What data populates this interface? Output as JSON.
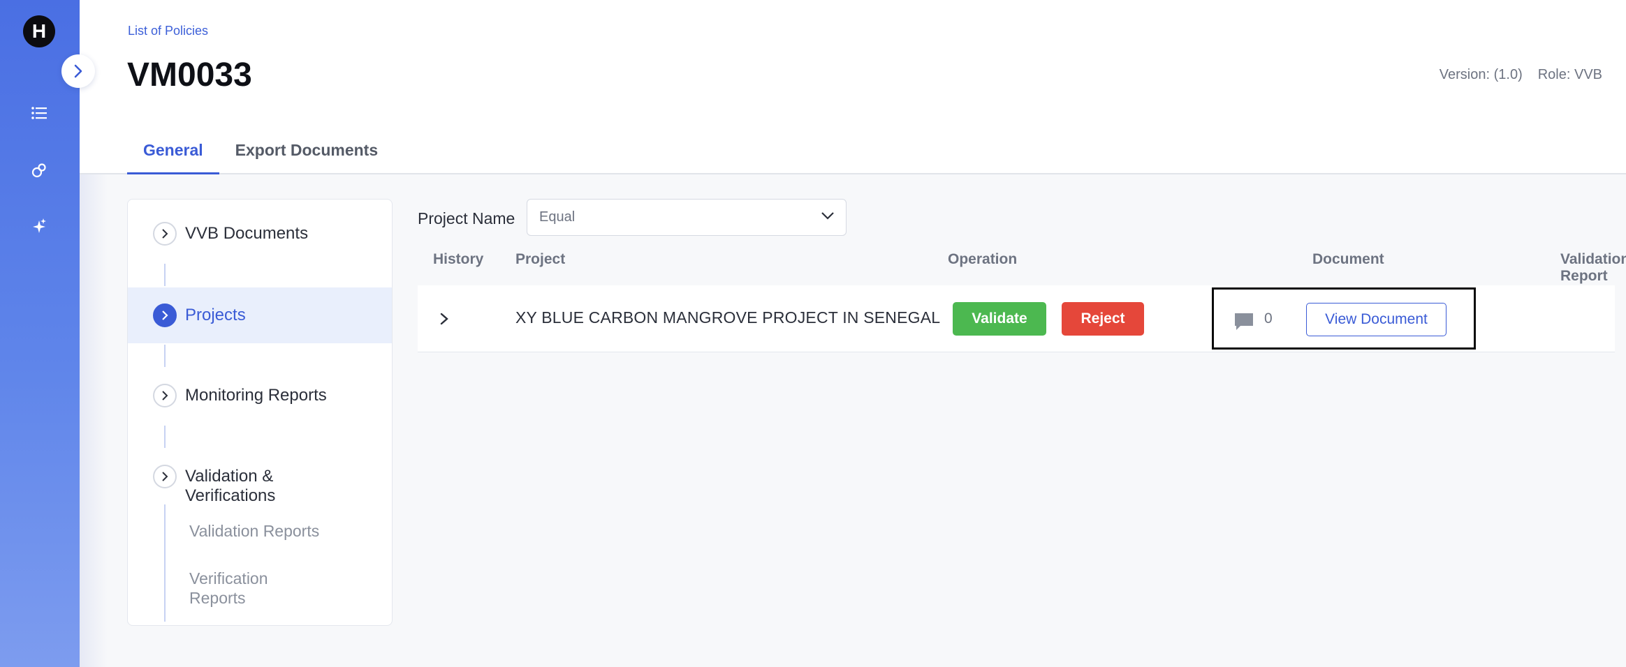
{
  "sidebar": {
    "logo_letter": "H",
    "icons": [
      "list-icon",
      "link-icon",
      "sparkle-icon"
    ]
  },
  "header": {
    "breadcrumb": "List of Policies",
    "title": "VM0033",
    "version": "Version: (1.0)",
    "role": "Role: VVB",
    "tabs": [
      {
        "label": "General",
        "active": true
      },
      {
        "label": "Export Documents",
        "active": false
      }
    ]
  },
  "tree": {
    "items": [
      {
        "label": "VVB Documents",
        "active": false
      },
      {
        "label": "Projects",
        "active": true
      },
      {
        "label": "Monitoring Reports",
        "active": false
      },
      {
        "label": "Validation & Verifications",
        "active": false
      }
    ],
    "subitems": [
      "Validation Reports",
      "Verification Reports"
    ]
  },
  "filter": {
    "label": "Project Name",
    "value": "Equal"
  },
  "table": {
    "columns": [
      "History",
      "Project",
      "Operation",
      "Document",
      "Validation Report"
    ],
    "rows": [
      {
        "project": "XY BLUE CARBON MANGROVE PROJECT IN SENEGAL",
        "validate_label": "Validate",
        "reject_label": "Reject",
        "comment_count": "0",
        "view_label": "View Document"
      }
    ]
  },
  "colors": {
    "accent": "#3a5bd6",
    "validate": "#4cb850",
    "reject": "#e5473a",
    "rail_top": "#4a6fe3"
  }
}
